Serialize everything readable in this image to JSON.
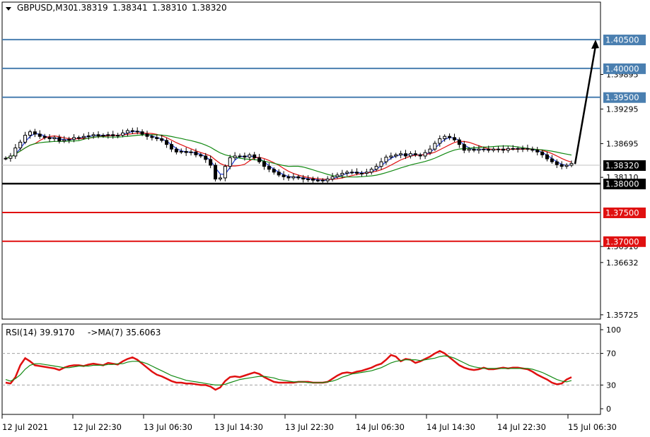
{
  "header": {
    "symbol": "GBPUSD,M30",
    "open": "1.38319",
    "high": "1.38341",
    "low": "1.38310",
    "close": "1.38320"
  },
  "rsi_header": {
    "label": "RSI(14) 39.9170",
    "ma_label": "->MA(7) 35.6063"
  },
  "colors": {
    "candle": "#000000",
    "ma_fast": "#1f3bd6",
    "ma_mid": "#e01010",
    "ma_slow": "#138a13",
    "resistance": "#4a7fb0",
    "support": "#e01010",
    "pivot": "#000000",
    "rsi": "#e01010",
    "rsi_ma": "#138a13",
    "arrow": "#000000"
  },
  "chart_data": [
    {
      "type": "candlestick",
      "symbol": "GBPUSD",
      "timeframe": "M30",
      "x_labels": [
        "12 Jul 2021",
        "12 Jul 22:30",
        "13 Jul 06:30",
        "13 Jul 14:30",
        "13 Jul 22:30",
        "14 Jul 06:30",
        "14 Jul 14:30",
        "14 Jul 22:30",
        "15 Jul 06:30"
      ],
      "y_ticks": [
        "1.39895",
        "1.39295",
        "1.38695",
        "1.38110",
        "1.36910",
        "1.36632",
        "1.35725"
      ],
      "ylim": [
        1.3565,
        1.4115
      ],
      "current_price": 1.3832,
      "close_approx": [
        1.3844,
        1.3848,
        1.3862,
        1.3872,
        1.3884,
        1.389,
        1.3886,
        1.3882,
        1.388,
        1.3878,
        1.388,
        1.3874,
        1.3876,
        1.3877,
        1.388,
        1.388,
        1.3882,
        1.3883,
        1.3885,
        1.3883,
        1.3884,
        1.3885,
        1.3883,
        1.3884,
        1.3888,
        1.3892,
        1.3891,
        1.389,
        1.3886,
        1.3882,
        1.388,
        1.3878,
        1.3875,
        1.3868,
        1.386,
        1.3855,
        1.3856,
        1.3854,
        1.3855,
        1.385,
        1.3848,
        1.3842,
        1.3832,
        1.3808,
        1.381,
        1.383,
        1.3845,
        1.3848,
        1.3848,
        1.3846,
        1.385,
        1.3845,
        1.3838,
        1.383,
        1.3825,
        1.382,
        1.3815,
        1.3812,
        1.381,
        1.3812,
        1.381,
        1.3808,
        1.3808,
        1.3806,
        1.3806,
        1.3805,
        1.3808,
        1.3812,
        1.3815,
        1.3818,
        1.382,
        1.382,
        1.3818,
        1.3818,
        1.382,
        1.3825,
        1.383,
        1.3838,
        1.3846,
        1.3848,
        1.385,
        1.3852,
        1.3848,
        1.3852,
        1.385,
        1.3848,
        1.3854,
        1.386,
        1.387,
        1.3878,
        1.3882,
        1.388,
        1.3876,
        1.3868,
        1.3858,
        1.386,
        1.3858,
        1.386,
        1.386,
        1.3858,
        1.386,
        1.386,
        1.3858,
        1.3861,
        1.3861,
        1.386,
        1.3861,
        1.386,
        1.3858,
        1.3855,
        1.385,
        1.3843,
        1.3838,
        1.3833,
        1.383,
        1.3832,
        1.3835
      ],
      "series": [
        {
          "name": "RSI(14)",
          "current": 39.917
        },
        {
          "name": "MA(7)",
          "current": 35.6063
        }
      ],
      "levels": [
        {
          "label": "1.40500",
          "value": 1.405,
          "kind": "resistance"
        },
        {
          "label": "1.40000",
          "value": 1.4,
          "kind": "resistance"
        },
        {
          "label": "1.39500",
          "value": 1.395,
          "kind": "resistance"
        },
        {
          "label": "1.38320",
          "value": 1.3832,
          "kind": "current"
        },
        {
          "label": "1.38000",
          "value": 1.38,
          "kind": "pivot"
        },
        {
          "label": "1.37500",
          "value": 1.375,
          "kind": "support"
        },
        {
          "label": "1.37000",
          "value": 1.37,
          "kind": "support"
        }
      ],
      "projection": {
        "from": 1.3834,
        "to": 1.405
      }
    },
    {
      "type": "line",
      "title": "RSI(14) 39.9170 ->MA(7) 35.6063",
      "y_ticks": [
        "100",
        "70",
        "30",
        "0"
      ],
      "ylim": [
        0,
        100
      ],
      "reference_levels": [
        70,
        30
      ],
      "series": [
        {
          "name": "RSI(14)",
          "values": [
            33,
            32,
            40,
            55,
            64,
            60,
            55,
            54,
            53,
            52,
            51,
            49,
            52,
            54,
            55,
            55,
            54,
            56,
            57,
            56,
            55,
            58,
            57,
            56,
            60,
            63,
            65,
            62,
            57,
            52,
            47,
            43,
            41,
            38,
            35,
            33,
            33,
            32,
            32,
            31,
            30,
            30,
            28,
            24,
            27,
            35,
            40,
            41,
            40,
            42,
            44,
            46,
            44,
            40,
            37,
            34,
            33,
            33,
            33,
            33,
            34,
            34,
            34,
            33,
            33,
            33,
            34,
            38,
            42,
            45,
            46,
            45,
            47,
            48,
            50,
            52,
            55,
            57,
            62,
            68,
            66,
            60,
            63,
            62,
            58,
            60,
            63,
            66,
            70,
            73,
            70,
            65,
            60,
            55,
            52,
            50,
            49,
            50,
            52,
            50,
            50,
            51,
            52,
            51,
            52,
            52,
            51,
            50,
            47,
            43,
            40,
            37,
            33,
            31,
            32,
            37,
            39.9
          ]
        },
        {
          "name": "MA(7)",
          "values": [
            37,
            35,
            38,
            43,
            50,
            55,
            57,
            57,
            56,
            55,
            54,
            53,
            52,
            52,
            53,
            54,
            54,
            54,
            55,
            55,
            55,
            56,
            56,
            57,
            57,
            59,
            60,
            60,
            59,
            57,
            54,
            51,
            48,
            45,
            42,
            40,
            38,
            36,
            35,
            34,
            33,
            32,
            31,
            30,
            30,
            31,
            33,
            35,
            37,
            38,
            39,
            40,
            41,
            41,
            40,
            39,
            37,
            36,
            35,
            34,
            34,
            34,
            33,
            33,
            33,
            33,
            34,
            35,
            37,
            40,
            42,
            44,
            45,
            46,
            47,
            48,
            50,
            52,
            55,
            58,
            60,
            61,
            62,
            62,
            62,
            61,
            62,
            63,
            64,
            66,
            67,
            66,
            64,
            61,
            58,
            55,
            53,
            52,
            51,
            51,
            51,
            51,
            51,
            51,
            51,
            51,
            51,
            51,
            50,
            48,
            46,
            43,
            40,
            37,
            35,
            34,
            35.6
          ]
        }
      ]
    }
  ]
}
